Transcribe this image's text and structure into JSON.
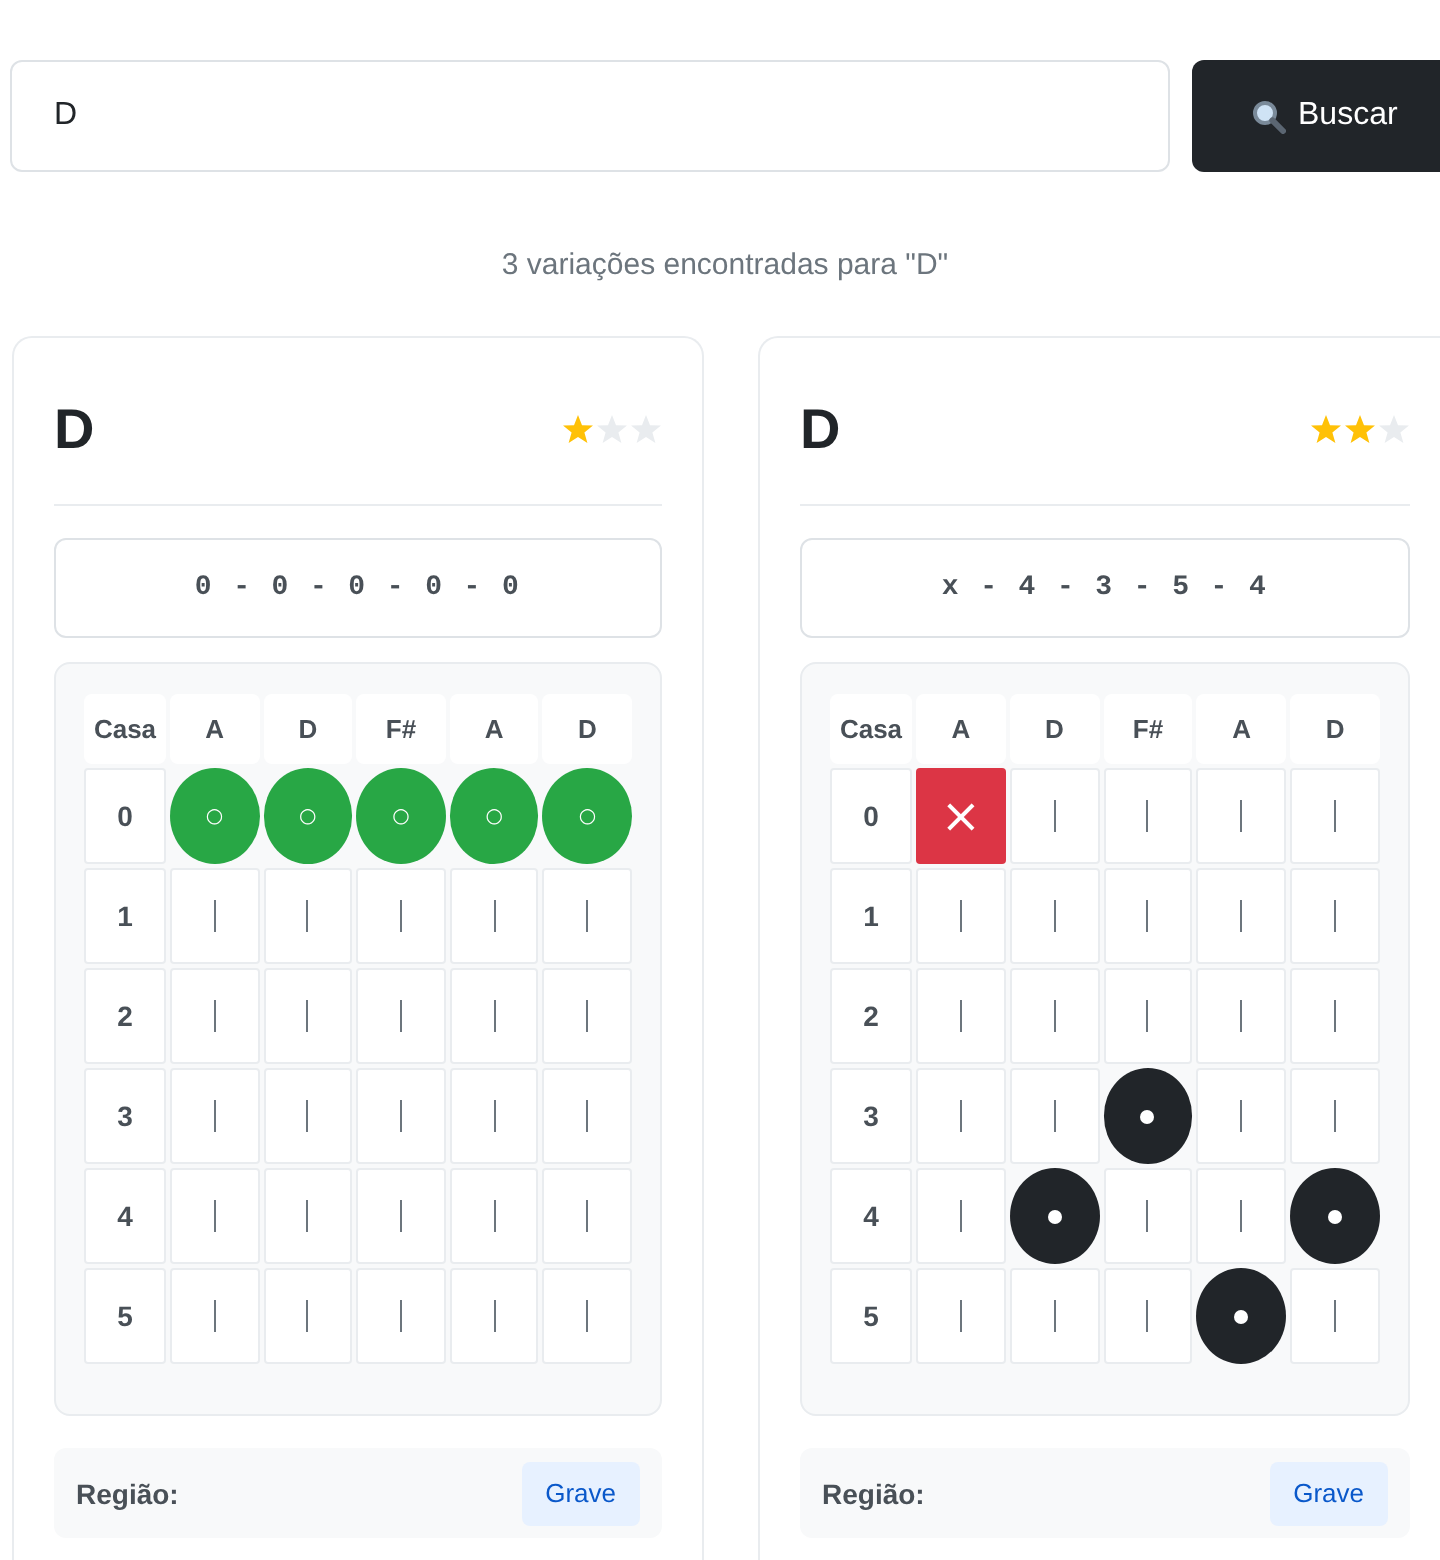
{
  "search": {
    "value": "D"
  },
  "search_button": {
    "label": "Buscar"
  },
  "result_summary": "3 variações encontradas para \"D\"",
  "cards": [
    {
      "title": "D",
      "stars": 1,
      "fingering": "0 - 0 - 0 - 0 - 0",
      "fretboard": {
        "corner_label": "Casa",
        "strings": [
          "A",
          "D",
          "F#",
          "A",
          "D"
        ],
        "rows": [
          {
            "fret": "0",
            "cells": [
              {
                "kind": "open",
                "symbol": "○"
              },
              {
                "kind": "open",
                "symbol": "○"
              },
              {
                "kind": "open",
                "symbol": "○"
              },
              {
                "kind": "open",
                "symbol": "○"
              },
              {
                "kind": "open",
                "symbol": "○"
              }
            ]
          },
          {
            "fret": "1",
            "cells": [
              {
                "kind": "empty"
              },
              {
                "kind": "empty"
              },
              {
                "kind": "empty"
              },
              {
                "kind": "empty"
              },
              {
                "kind": "empty"
              }
            ]
          },
          {
            "fret": "2",
            "cells": [
              {
                "kind": "empty"
              },
              {
                "kind": "empty"
              },
              {
                "kind": "empty"
              },
              {
                "kind": "empty"
              },
              {
                "kind": "empty"
              }
            ]
          },
          {
            "fret": "3",
            "cells": [
              {
                "kind": "empty"
              },
              {
                "kind": "empty"
              },
              {
                "kind": "empty"
              },
              {
                "kind": "empty"
              },
              {
                "kind": "empty"
              }
            ]
          },
          {
            "fret": "4",
            "cells": [
              {
                "kind": "empty"
              },
              {
                "kind": "empty"
              },
              {
                "kind": "empty"
              },
              {
                "kind": "empty"
              },
              {
                "kind": "empty"
              }
            ]
          },
          {
            "fret": "5",
            "cells": [
              {
                "kind": "empty"
              },
              {
                "kind": "empty"
              },
              {
                "kind": "empty"
              },
              {
                "kind": "empty"
              },
              {
                "kind": "empty"
              }
            ]
          }
        ]
      },
      "details": [
        {
          "label": "Região:",
          "value": "Grave"
        }
      ]
    },
    {
      "title": "D",
      "stars": 2,
      "fingering": "x - 4 - 3 - 5 - 4",
      "fretboard": {
        "corner_label": "Casa",
        "strings": [
          "A",
          "D",
          "F#",
          "A",
          "D"
        ],
        "rows": [
          {
            "fret": "0",
            "cells": [
              {
                "kind": "muted",
                "symbol": "×"
              },
              {
                "kind": "empty"
              },
              {
                "kind": "empty"
              },
              {
                "kind": "empty"
              },
              {
                "kind": "empty"
              }
            ]
          },
          {
            "fret": "1",
            "cells": [
              {
                "kind": "empty"
              },
              {
                "kind": "empty"
              },
              {
                "kind": "empty"
              },
              {
                "kind": "empty"
              },
              {
                "kind": "empty"
              }
            ]
          },
          {
            "fret": "2",
            "cells": [
              {
                "kind": "empty"
              },
              {
                "kind": "empty"
              },
              {
                "kind": "empty"
              },
              {
                "kind": "empty"
              },
              {
                "kind": "empty"
              }
            ]
          },
          {
            "fret": "3",
            "cells": [
              {
                "kind": "empty"
              },
              {
                "kind": "empty"
              },
              {
                "kind": "fretted"
              },
              {
                "kind": "empty"
              },
              {
                "kind": "empty"
              }
            ]
          },
          {
            "fret": "4",
            "cells": [
              {
                "kind": "empty"
              },
              {
                "kind": "fretted"
              },
              {
                "kind": "empty"
              },
              {
                "kind": "empty"
              },
              {
                "kind": "fretted"
              }
            ]
          },
          {
            "fret": "5",
            "cells": [
              {
                "kind": "empty"
              },
              {
                "kind": "empty"
              },
              {
                "kind": "empty"
              },
              {
                "kind": "fretted"
              },
              {
                "kind": "empty"
              }
            ]
          }
        ]
      },
      "details": [
        {
          "label": "Região:",
          "value": "Grave"
        }
      ]
    }
  ]
}
